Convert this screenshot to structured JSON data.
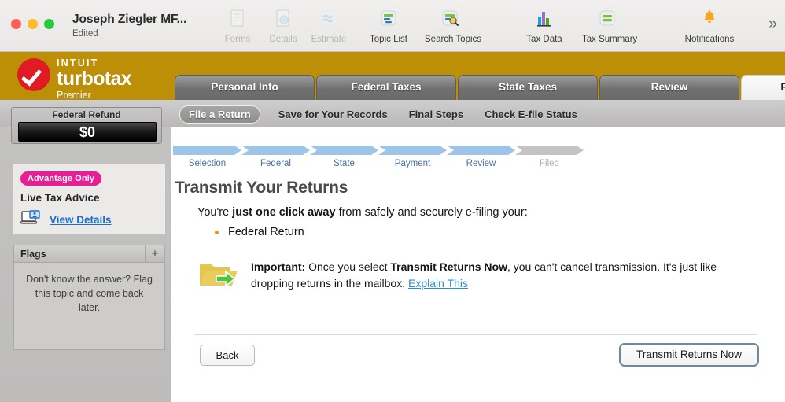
{
  "window": {
    "document_title": "Joseph Ziegler MF...",
    "document_status": "Edited",
    "traffic_lights": [
      "close",
      "minimize",
      "zoom"
    ]
  },
  "toolbar": {
    "overflow_label": "»",
    "items": [
      {
        "label": "Forms",
        "icon": "forms-icon",
        "enabled": false
      },
      {
        "label": "Details",
        "icon": "details-icon",
        "enabled": false
      },
      {
        "label": "Estimate",
        "icon": "estimate-icon",
        "enabled": false
      },
      {
        "label": "Topic List",
        "icon": "topic-list-icon",
        "enabled": true
      },
      {
        "label": "Search Topics",
        "icon": "search-topics-icon",
        "enabled": true
      },
      {
        "label": "Tax Data",
        "icon": "tax-data-icon",
        "enabled": true
      },
      {
        "label": "Tax Summary",
        "icon": "tax-summary-icon",
        "enabled": true
      },
      {
        "label": "Notifications",
        "icon": "bell-icon",
        "enabled": true
      }
    ]
  },
  "brand": {
    "intuit": "INTUIT",
    "product": "turbotax",
    "edition": "Premier",
    "bar_color": "#bc8f06",
    "check_color": "#e01b24"
  },
  "main_tabs": [
    {
      "label": "Personal Info",
      "active": false
    },
    {
      "label": "Federal Taxes",
      "active": false
    },
    {
      "label": "State Taxes",
      "active": false
    },
    {
      "label": "Review",
      "active": false
    },
    {
      "label": "File",
      "active": true
    }
  ],
  "sub_nav": [
    {
      "label": "File a Return",
      "active": true
    },
    {
      "label": "Save for Your Records",
      "active": false
    },
    {
      "label": "Final Steps",
      "active": false
    },
    {
      "label": "Check E-file Status",
      "active": false
    }
  ],
  "sidebar": {
    "refund": {
      "label": "Federal Refund",
      "amount": "$0"
    },
    "advantage": {
      "badge": "Advantage Only",
      "badge_color": "#e81e97",
      "title": "Live Tax Advice",
      "link": "View Details",
      "link_color": "#1c6fcb",
      "icon": "laptop-advisor-icon"
    },
    "flags": {
      "title": "Flags",
      "add_label": "+",
      "empty_message": "Don't know the answer? Flag this topic and come back later."
    }
  },
  "progress": {
    "steps": [
      {
        "label": "Selection",
        "done": true
      },
      {
        "label": "Federal",
        "done": true
      },
      {
        "label": "State",
        "done": true
      },
      {
        "label": "Payment",
        "done": true
      },
      {
        "label": "Review",
        "done": true
      },
      {
        "label": "Filed",
        "done": false
      }
    ],
    "active_color": "#9fc4ea",
    "inactive_color": "#c4c4c4"
  },
  "main": {
    "heading": "Transmit Your Returns",
    "lead_prefix": "You're ",
    "lead_bold": "just one click away",
    "lead_suffix": " from safely and securely e-filing your:",
    "returns": [
      "Federal Return"
    ],
    "notice": {
      "icon": "folder-export-icon",
      "bold_label": "Important:",
      "text_1": " Once you select ",
      "bold_action": "Transmit Returns Now",
      "text_2": ", you can't cancel transmission. It's just like dropping returns in the mailbox. ",
      "link": "Explain This",
      "link_color": "#2b8fd8"
    },
    "back_button": "Back",
    "transmit_button": "Transmit Returns Now"
  }
}
